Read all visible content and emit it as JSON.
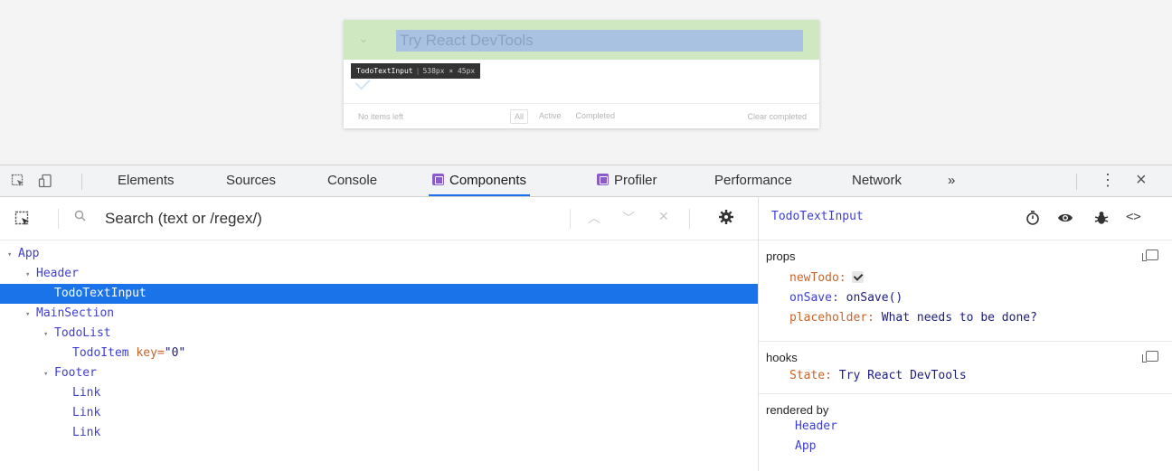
{
  "preview": {
    "input_value": "Try React DevTools",
    "tooltip_component": "TodoTextInput",
    "tooltip_size": "538px × 45px",
    "items_left": "No items left",
    "filters": [
      "All",
      "Active",
      "Completed"
    ],
    "clear_completed": "Clear completed"
  },
  "tabs": {
    "elements": "Elements",
    "sources": "Sources",
    "console": "Console",
    "components": "Components",
    "profiler": "Profiler",
    "performance": "Performance",
    "network": "Network",
    "more": "»"
  },
  "search": {
    "placeholder": "Search (text or /regex/)"
  },
  "tree": [
    {
      "indent": 0,
      "expanded": true,
      "name": "App"
    },
    {
      "indent": 1,
      "expanded": true,
      "name": "Header"
    },
    {
      "indent": 2,
      "expanded": null,
      "name": "TodoTextInput",
      "selected": true
    },
    {
      "indent": 1,
      "expanded": true,
      "name": "MainSection"
    },
    {
      "indent": 2,
      "expanded": true,
      "name": "TodoList"
    },
    {
      "indent": 3,
      "expanded": null,
      "name": "TodoItem",
      "key": "0"
    },
    {
      "indent": 2,
      "expanded": true,
      "name": "Footer"
    },
    {
      "indent": 3,
      "expanded": null,
      "name": "Link"
    },
    {
      "indent": 3,
      "expanded": null,
      "name": "Link"
    },
    {
      "indent": 3,
      "expanded": null,
      "name": "Link"
    }
  ],
  "inspector": {
    "selected_name": "TodoTextInput",
    "props_title": "props",
    "props": {
      "newTodo_key": "newTodo",
      "newTodo_checked": true,
      "onSave_key": "onSave",
      "onSave_value": "onSave()",
      "placeholder_key": "placeholder",
      "placeholder_value": "What needs to be done?"
    },
    "hooks_title": "hooks",
    "hooks": {
      "state_key": "State",
      "state_value": "Try React DevTools"
    },
    "rendered_by_title": "rendered by",
    "rendered_by": [
      "Header",
      "App"
    ]
  },
  "colors": {
    "accent": "#1a73e8",
    "component_name": "#3e3ed4",
    "prop_key": "#c8642c",
    "prop_value": "#1c1c7c",
    "badge": "#8a5cc9"
  },
  "icons": [
    "inspect-icon",
    "device-toggle-icon",
    "search-icon",
    "settings-icon",
    "timer-icon",
    "eye-icon",
    "bug-icon",
    "source-icon",
    "copy-icon",
    "kebab-icon",
    "close-icon"
  ]
}
